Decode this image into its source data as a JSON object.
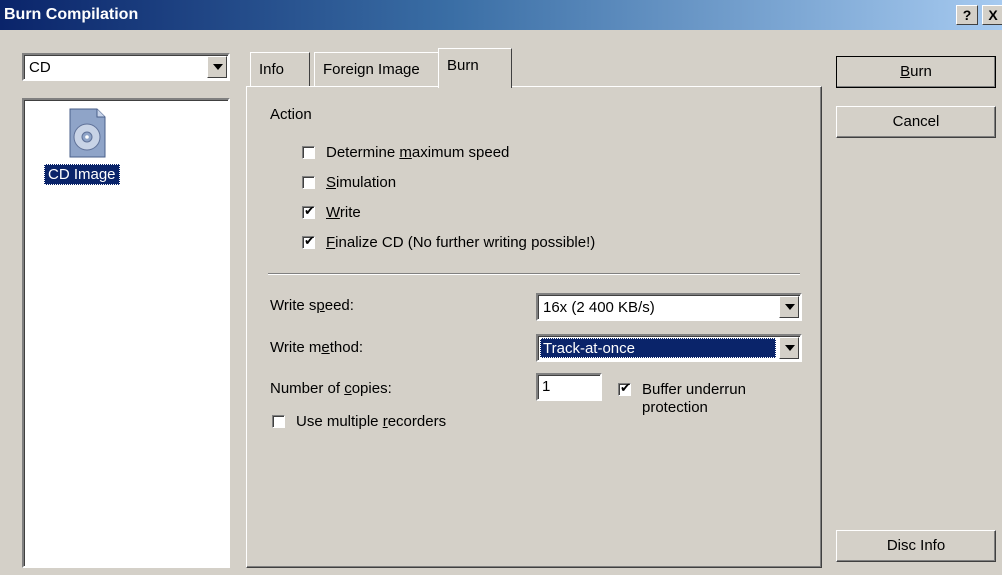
{
  "window": {
    "title": "Burn Compilation",
    "help_label": "?",
    "close_label": "X"
  },
  "left": {
    "media_combo_value": "CD",
    "item_label": "CD Image"
  },
  "tabs": [
    {
      "label": "Info"
    },
    {
      "label": "Foreign Image"
    },
    {
      "label": "Burn"
    }
  ],
  "burn_tab": {
    "action_heading": "Action",
    "options": [
      {
        "pre": "Determine ",
        "mnemonic": "m",
        "post": "aximum speed",
        "checked": false
      },
      {
        "pre": "",
        "mnemonic": "S",
        "post": "imulation",
        "checked": false
      },
      {
        "pre": "",
        "mnemonic": "W",
        "post": "rite",
        "checked": true
      },
      {
        "pre": "",
        "mnemonic": "F",
        "post": "inalize CD (No further writing possible!)",
        "checked": true
      }
    ],
    "write_speed_label": {
      "pre": "Write s",
      "mnemonic": "p",
      "post": "eed:"
    },
    "write_speed_value": "16x (2 400 KB/s)",
    "write_method_label": {
      "pre": "Write m",
      "mnemonic": "e",
      "post": "thod:"
    },
    "write_method_value": "Track-at-once",
    "copies_label": {
      "pre": "Number of ",
      "mnemonic": "c",
      "post": "opies:"
    },
    "copies_value": "1",
    "buffer_underrun": {
      "line1": "Buffer underrun",
      "line2": "protection",
      "checked": true
    },
    "multiple_recorders": {
      "pre": "Use multiple ",
      "mnemonic": "r",
      "post": "ecorders",
      "checked": false
    }
  },
  "buttons": {
    "burn": {
      "mnemonic": "B",
      "post": "urn"
    },
    "cancel": "Cancel",
    "disc_info": "Disc Info"
  },
  "colors": {
    "titlebar_start": "#0a246a",
    "titlebar_end": "#a6caf0",
    "selection": "#0a246a",
    "face": "#d4d0c8"
  }
}
